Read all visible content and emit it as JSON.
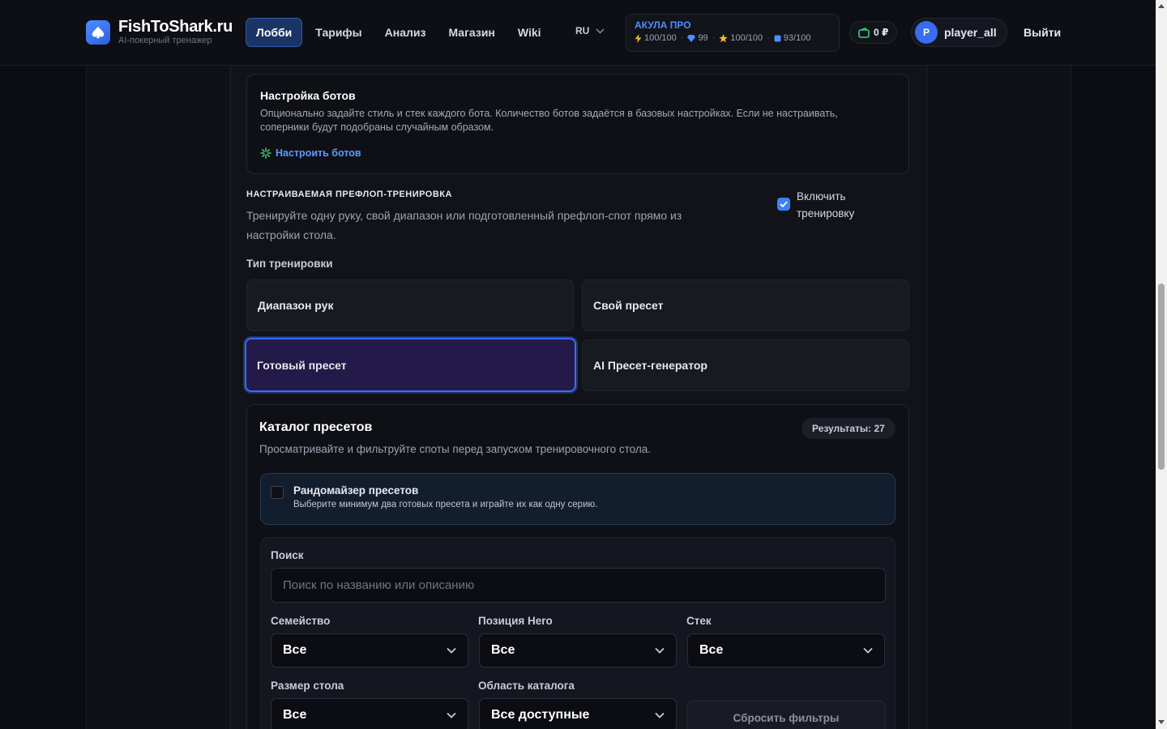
{
  "header": {
    "logo_name": "FishToShark.ru",
    "logo_tagline": "AI-покерный тренажер",
    "nav": [
      {
        "label": "Лобби",
        "active": true
      },
      {
        "label": "Тарифы"
      },
      {
        "label": "Анализ"
      },
      {
        "label": "Магазин"
      },
      {
        "label": "Wiki"
      }
    ],
    "language": "RU",
    "plan": {
      "title": "АКУЛА ПРО",
      "stats": [
        "100/100",
        "99",
        "100/100",
        "93/100"
      ]
    },
    "wallet": "0 ₽",
    "user": {
      "initial": "P",
      "name": "player_all"
    },
    "logout": "Выйти"
  },
  "bots": {
    "title": "Настройка ботов",
    "description": "Опционально задайте стиль и стек каждого бота. Количество ботов задаётся в базовых настройках. Если не настраивать, соперники будут подобраны случайным образом.",
    "link": "Настроить ботов"
  },
  "training": {
    "heading": "НАСТРАИВАЕМАЯ ПРЕФЛОП-ТРЕНИРОВКА",
    "description": "Тренируйте одну руку, свой диапазон или подготовленный префлоп-спот прямо из настройки стола.",
    "toggle_label": "Включить тренировку",
    "toggle_checked": true,
    "type_label": "Тип тренировки",
    "types": [
      "Диапазон рук",
      "Свой пресет",
      "Готовый пресет",
      "AI Пресет-генератор"
    ],
    "selected_type": "Готовый пресет"
  },
  "catalog": {
    "title": "Каталог пресетов",
    "description": "Просматривайте и фильтруйте споты перед запуском тренировочного стола.",
    "results": "Результаты: 27",
    "randomizer": {
      "title": "Рандомайзер пресетов",
      "description": "Выберите минимум два готовых пресета и играйте их как одну серию."
    },
    "filters": {
      "search_label": "Поиск",
      "search_placeholder": "Поиск по названию или описанию",
      "family_label": "Семейство",
      "family_value": "Все",
      "position_label": "Позиция Hero",
      "position_value": "Все",
      "stack_label": "Стек",
      "stack_value": "Все",
      "table_label": "Размер стола",
      "table_value": "Все",
      "scope_label": "Область каталога",
      "scope_value": "Все доступные",
      "reset": "Сбросить фильтры"
    }
  },
  "colors": {
    "accent": "#3a6cf0",
    "link": "#5b9cff",
    "selected_bg": "#241a4a"
  }
}
